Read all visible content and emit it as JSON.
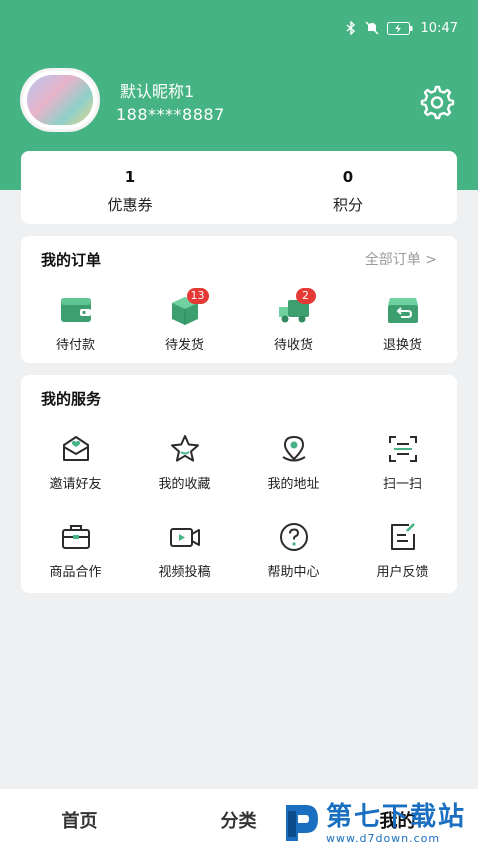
{
  "status_bar": {
    "time": "10:47",
    "icons": [
      "bluetooth-icon",
      "mute-icon",
      "battery-icon"
    ]
  },
  "profile": {
    "nickname": "默认昵称1",
    "phone": "188****8887",
    "settings_icon": "gear-icon"
  },
  "stats": [
    {
      "value": "1",
      "label": "优惠券"
    },
    {
      "value": "0",
      "label": "积分"
    }
  ],
  "orders": {
    "title": "我的订单",
    "all_link": "全部订单 >",
    "items": [
      {
        "label": "待付款",
        "icon": "wallet-icon",
        "badge": ""
      },
      {
        "label": "待发货",
        "icon": "package-icon",
        "badge": "13"
      },
      {
        "label": "待收货",
        "icon": "truck-icon",
        "badge": "2"
      },
      {
        "label": "退换货",
        "icon": "return-box-icon",
        "badge": ""
      }
    ]
  },
  "services": {
    "title": "我的服务",
    "items": [
      {
        "label": "邀请好友",
        "icon": "invite-mail-icon"
      },
      {
        "label": "我的收藏",
        "icon": "star-icon"
      },
      {
        "label": "我的地址",
        "icon": "location-pin-icon"
      },
      {
        "label": "扫一扫",
        "icon": "scan-icon"
      },
      {
        "label": "商品合作",
        "icon": "briefcase-icon"
      },
      {
        "label": "视频投稿",
        "icon": "video-camera-icon"
      },
      {
        "label": "帮助中心",
        "icon": "help-circle-icon"
      },
      {
        "label": "用户反馈",
        "icon": "feedback-edit-icon"
      }
    ]
  },
  "tabbar": [
    {
      "label": "首页"
    },
    {
      "label": "分类"
    },
    {
      "label": "我的"
    }
  ],
  "watermark": {
    "title": "第七下载站",
    "url": "www.d7down.com"
  },
  "colors": {
    "brand_green": "#45b383",
    "badge_red": "#e53935",
    "watermark_blue": "#1a6fc0"
  }
}
